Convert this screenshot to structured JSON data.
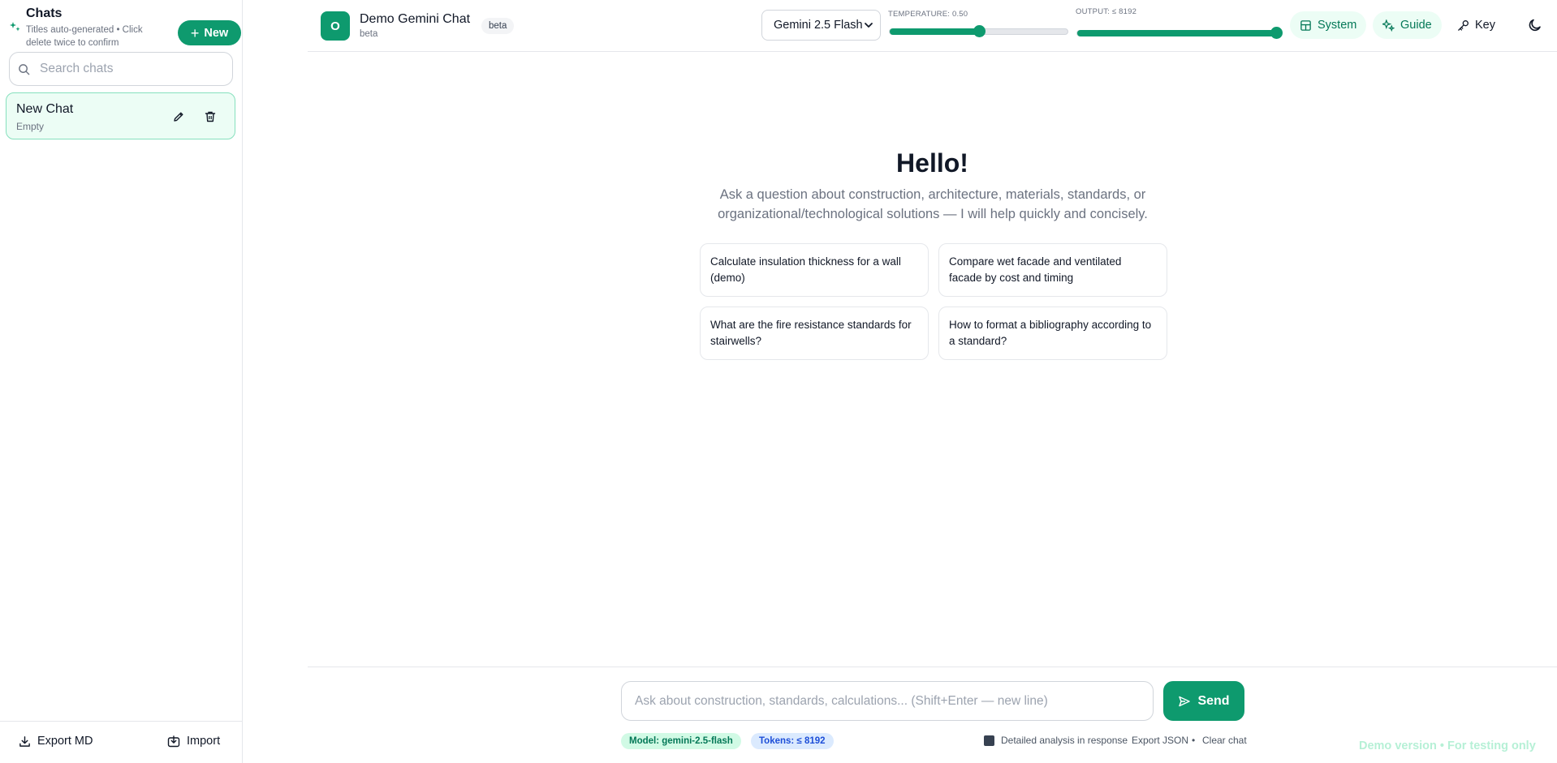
{
  "sidebar": {
    "title": "Chats",
    "subtitle": "Titles auto-generated • Click delete twice to confirm",
    "new_label": "New",
    "search": {
      "placeholder": "Search chats"
    },
    "chats": [
      {
        "name": "New Chat",
        "meta": "Empty"
      }
    ],
    "footer": {
      "export_label": "Export MD",
      "import_label": "Import"
    }
  },
  "header": {
    "avatar_letter": "O",
    "title": "Demo Gemini Chat",
    "subtitle": "beta",
    "badge": "beta",
    "model": {
      "selected": "Gemini 2.5 Flash"
    },
    "temperature": {
      "label": "TEMPERATURE: 0.50",
      "value": 0.5,
      "min": 0,
      "max": 1
    },
    "output": {
      "label": "OUTPUT: ≤ 8192",
      "fraction": 1.0
    },
    "buttons": {
      "system": "System",
      "guide": "Guide",
      "key": "Key"
    }
  },
  "main": {
    "greeting": "Hello!",
    "intro": "Ask a question about construction, architecture, materials, standards, or organizational/technological solutions — I will help quickly and concisely.",
    "suggestions": [
      "Calculate insulation thickness for a wall (demo)",
      "Compare wet facade and ventilated facade by cost and timing",
      "What are the fire resistance standards for stairwells?",
      "How to format a bibliography according to a standard?"
    ]
  },
  "composer": {
    "placeholder": "Ask about construction, standards, calculations... (Shift+Enter — new line)",
    "send_label": "Send",
    "model_pill": "Model: gemini-2.5-flash",
    "tokens_pill": "Tokens: ≤ 8192",
    "detailed_label": "Detailed analysis in response",
    "export_json": "Export JSON",
    "separator": "•",
    "clear_chat": "Clear chat"
  },
  "watermark": "Demo version • For testing only",
  "colors": {
    "accent": "#0e9a6e",
    "accent_light": "#ecfdf5",
    "token_blue": "#1d4ed8"
  }
}
